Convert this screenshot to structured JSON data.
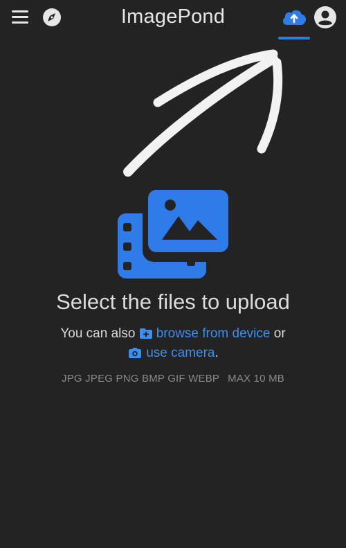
{
  "header": {
    "title": "ImagePond",
    "menu_icon": "hamburger-menu-icon",
    "explore_icon": "compass-icon",
    "upload_icon": "cloud-upload-icon",
    "account_icon": "account-circle-icon",
    "active_tab": "upload"
  },
  "upload": {
    "heading": "Select the files to upload",
    "also_text": "You can also",
    "browse_label": "browse from device",
    "or_text": "or",
    "camera_label": "use camera",
    "period": ".",
    "formats": "JPG JPEG PNG BMP GIF WEBP",
    "max_size": "MAX 10 MB",
    "illustration_icon": "image-and-video-icon",
    "browse_icon": "folder-plus-icon",
    "camera_icon": "camera-icon"
  },
  "colors": {
    "background": "#232323",
    "accent": "#2f7ce8",
    "link": "#3d8ef0",
    "text": "#e6e6e6",
    "muted": "#8a8a8a"
  }
}
